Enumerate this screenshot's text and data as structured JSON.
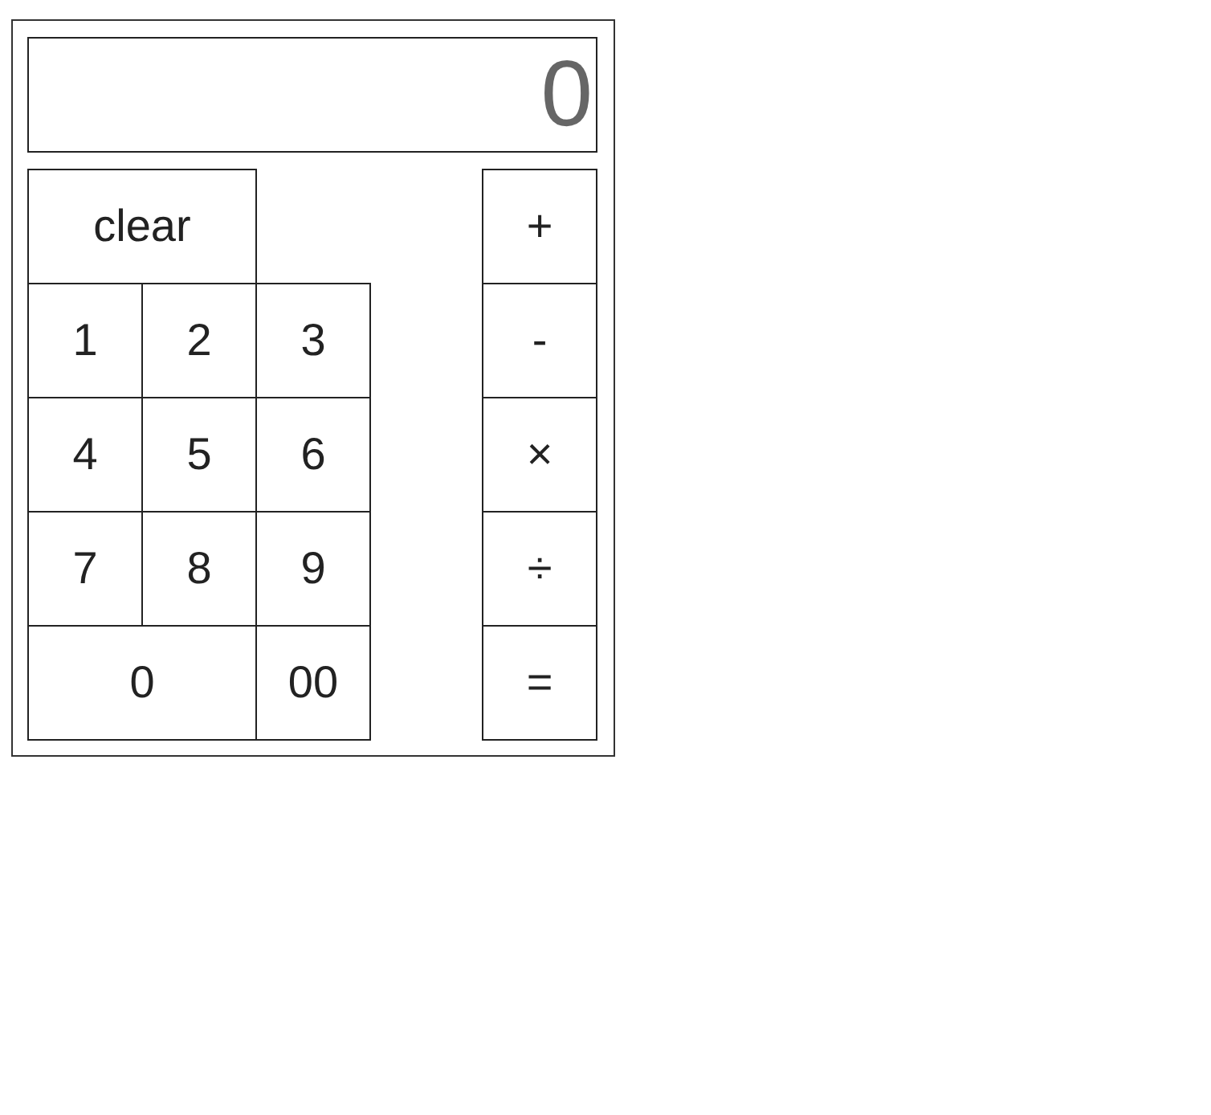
{
  "display": {
    "value": "0"
  },
  "keypad": [
    [
      {
        "label": "clear",
        "wide": true
      }
    ],
    [
      {
        "label": "1",
        "wide": false
      },
      {
        "label": "2",
        "wide": false
      },
      {
        "label": "3",
        "wide": false
      }
    ],
    [
      {
        "label": "4",
        "wide": false
      },
      {
        "label": "5",
        "wide": false
      },
      {
        "label": "6",
        "wide": false
      }
    ],
    [
      {
        "label": "7",
        "wide": false
      },
      {
        "label": "8",
        "wide": false
      },
      {
        "label": "9",
        "wide": false
      }
    ],
    [
      {
        "label": "0",
        "wide": true
      },
      {
        "label": "00",
        "wide": false
      }
    ]
  ],
  "operators": [
    "+",
    "-",
    "×",
    "÷",
    "="
  ]
}
